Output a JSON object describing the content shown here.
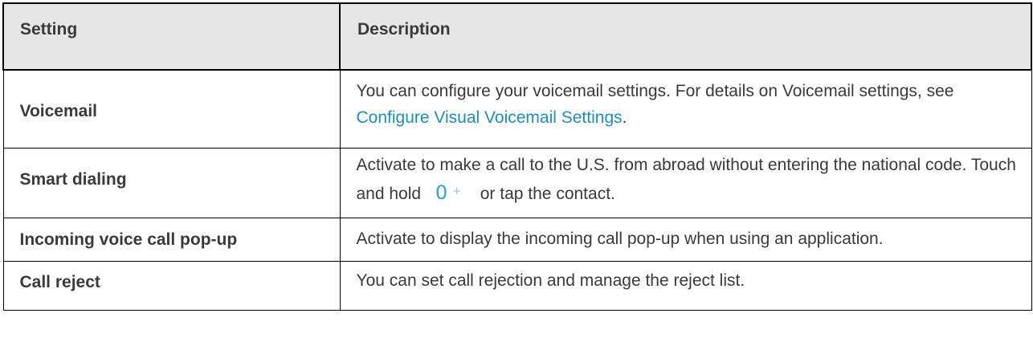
{
  "table": {
    "header": {
      "setting": "Setting",
      "description": "Description"
    },
    "rows": [
      {
        "setting": "Voicemail",
        "desc_before": "You can configure your voicemail settings. For details on Voicemail settings, see ",
        "link": "Configure Visual Voicemail Settings",
        "desc_after": "."
      },
      {
        "setting": "Smart dialing",
        "desc_before": "Activate to make a call to the U.S. from abroad without entering the national code. Touch and hold ",
        "key": "0",
        "key_sub": "+",
        "desc_after": " or tap the contact."
      },
      {
        "setting": "Incoming voice call pop-up",
        "desc": "Activate to display the incoming call pop-up when using an application."
      },
      {
        "setting": "Call reject",
        "desc": "You can set call rejection and manage the reject list."
      }
    ]
  },
  "colors": {
    "header_bg": "#e6e6e6",
    "text": "#3a3a3a",
    "link": "#1a8fc1",
    "key": "#29a8d8"
  }
}
